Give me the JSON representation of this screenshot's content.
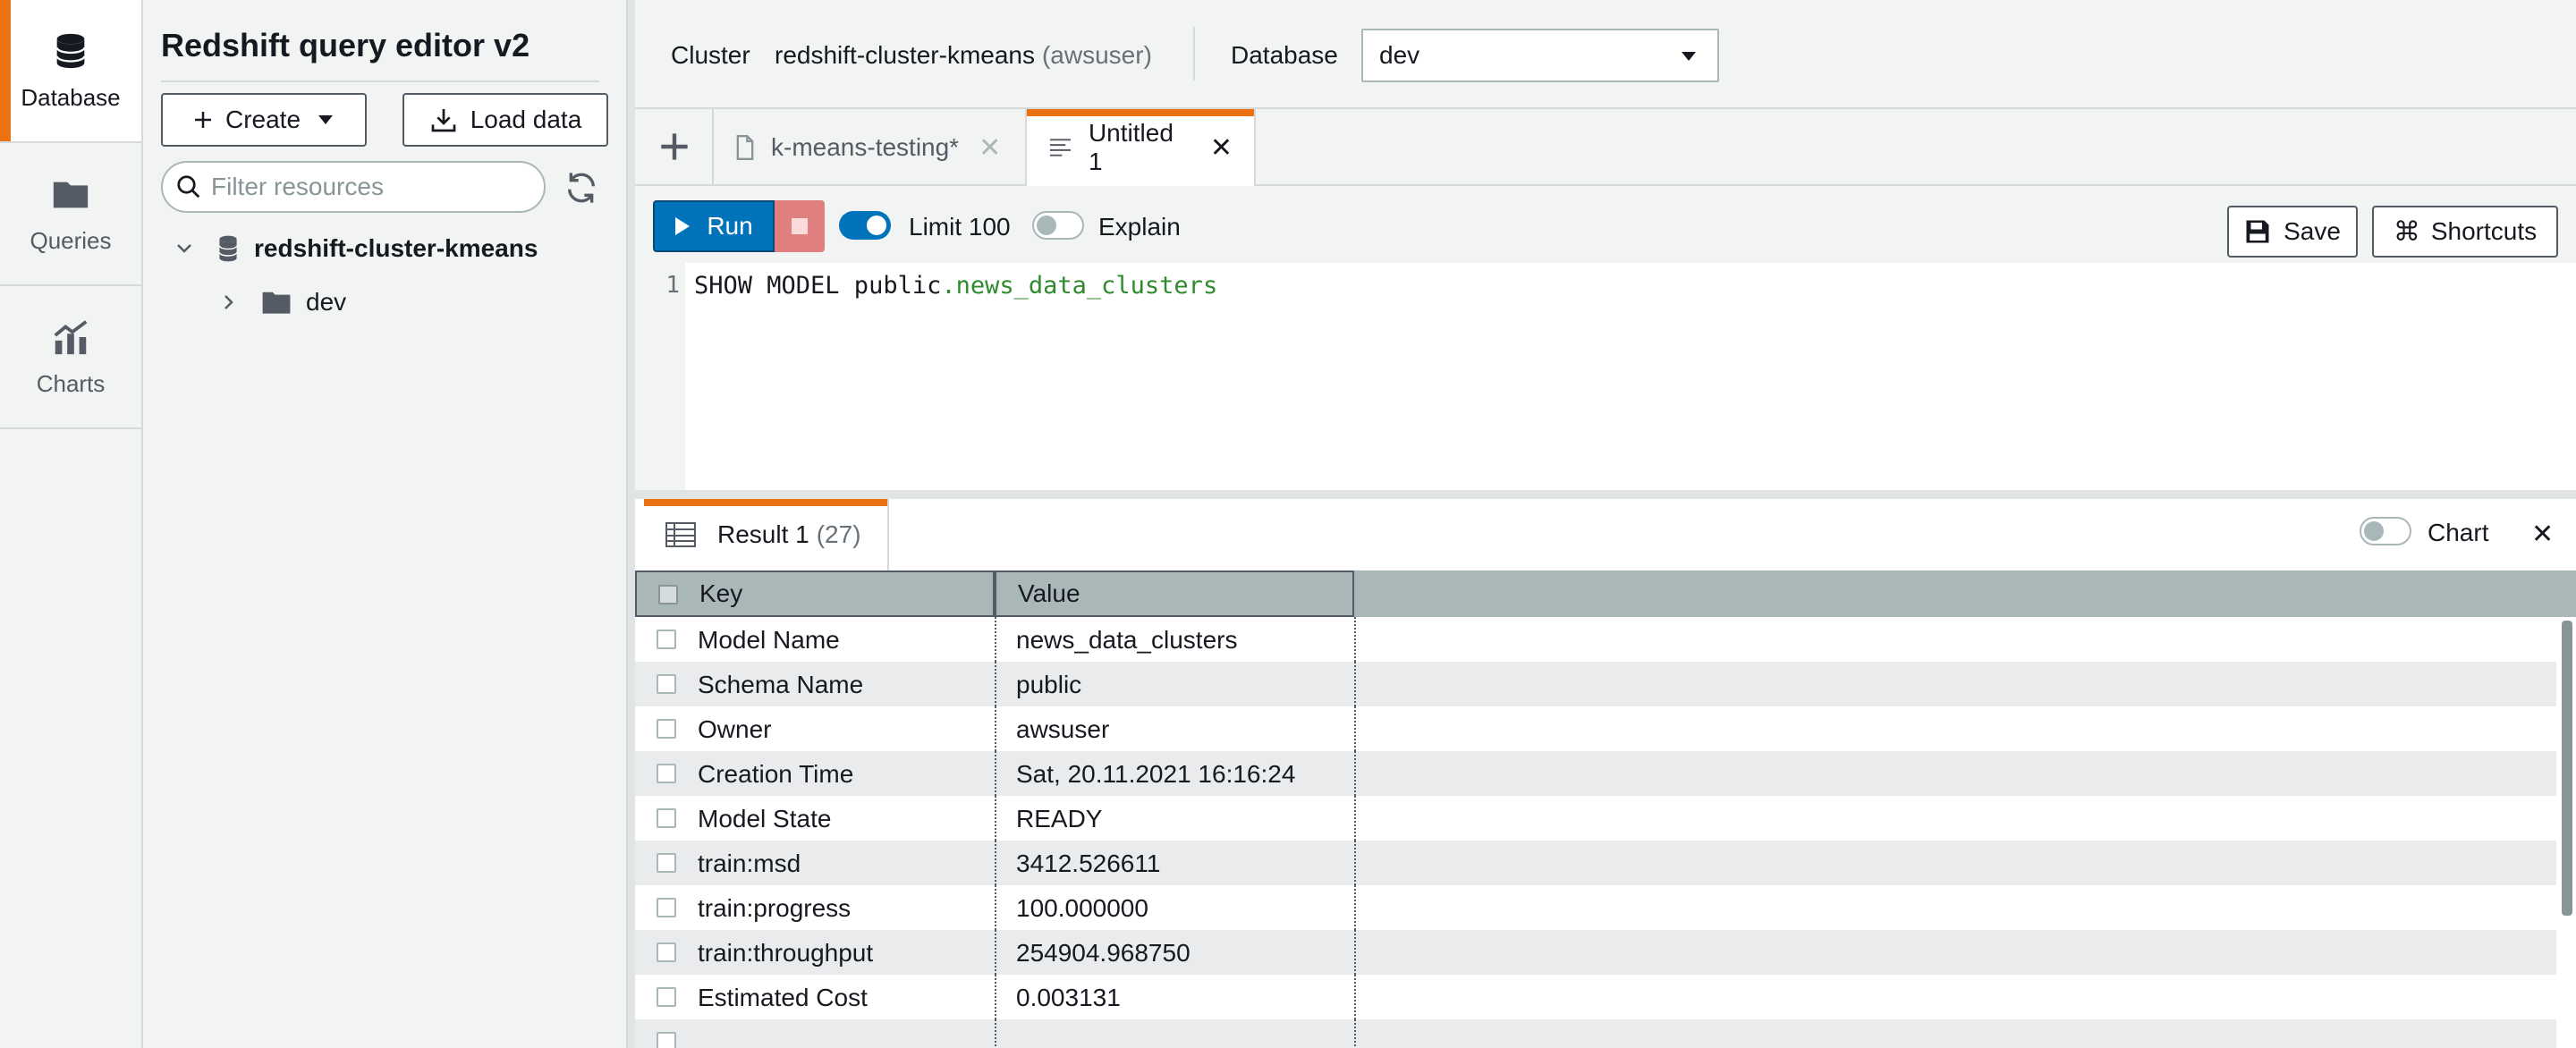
{
  "rail": {
    "items": [
      {
        "label": "Database",
        "icon": "database-icon"
      },
      {
        "label": "Queries",
        "icon": "folder-icon"
      },
      {
        "label": "Charts",
        "icon": "chart-icon"
      }
    ]
  },
  "panel": {
    "title": "Redshift query editor v2",
    "create_label": "Create",
    "load_label": "Load data",
    "filter_placeholder": "Filter resources",
    "tree": {
      "cluster": "redshift-cluster-kmeans",
      "database": "dev"
    }
  },
  "topbar": {
    "cluster_label": "Cluster",
    "cluster_name": "redshift-cluster-kmeans",
    "cluster_user": "(awsuser)",
    "database_label": "Database",
    "database_value": "dev"
  },
  "tabs": [
    {
      "label": "k-means-testing*"
    },
    {
      "label": "Untitled 1"
    }
  ],
  "toolbar": {
    "run_label": "Run",
    "limit_label": "Limit 100",
    "limit_on": true,
    "explain_label": "Explain",
    "explain_on": false,
    "save_label": "Save",
    "shortcuts_label": "Shortcuts"
  },
  "editor": {
    "line_number": "1",
    "code_keyword": "SHOW MODEL public",
    "code_table": ".news_data_clusters"
  },
  "results": {
    "tab_label": "Result 1",
    "count": "(27)",
    "chart_label": "Chart",
    "chart_on": false,
    "columns": [
      "Key",
      "Value"
    ],
    "rows": [
      {
        "key": "Model Name",
        "value": "news_data_clusters"
      },
      {
        "key": "Schema Name",
        "value": "public"
      },
      {
        "key": "Owner",
        "value": "awsuser"
      },
      {
        "key": "Creation Time",
        "value": "Sat, 20.11.2021 16:16:24"
      },
      {
        "key": "Model State",
        "value": "READY"
      },
      {
        "key": "train:msd",
        "value": "3412.526611"
      },
      {
        "key": "train:progress",
        "value": "100.000000"
      },
      {
        "key": "train:throughput",
        "value": "254904.968750"
      },
      {
        "key": "Estimated Cost",
        "value": "0.003131"
      },
      {
        "key": "",
        "value": ""
      }
    ]
  },
  "colors": {
    "accent": "#ec7211",
    "primary": "#0073bb",
    "sql_identifier": "#2e8b2e"
  }
}
